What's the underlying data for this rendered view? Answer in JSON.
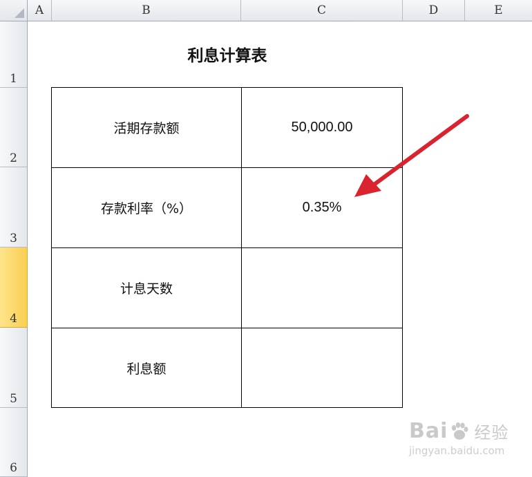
{
  "columns": [
    "A",
    "B",
    "C",
    "D",
    "E"
  ],
  "rows": [
    "1",
    "2",
    "3",
    "4",
    "5",
    "6"
  ],
  "selected_row": "4",
  "title": "利息计算表",
  "table": [
    {
      "label": "活期存款额",
      "value": "50,000.00"
    },
    {
      "label": "存款利率（%）",
      "value": "0.35%"
    },
    {
      "label": "计息天数",
      "value": ""
    },
    {
      "label": "利息额",
      "value": ""
    }
  ],
  "arrow_color": "#d9232e",
  "watermark": {
    "brand_left": "Bai",
    "brand_right": "经验",
    "url": "jingyan.baidu.com"
  }
}
